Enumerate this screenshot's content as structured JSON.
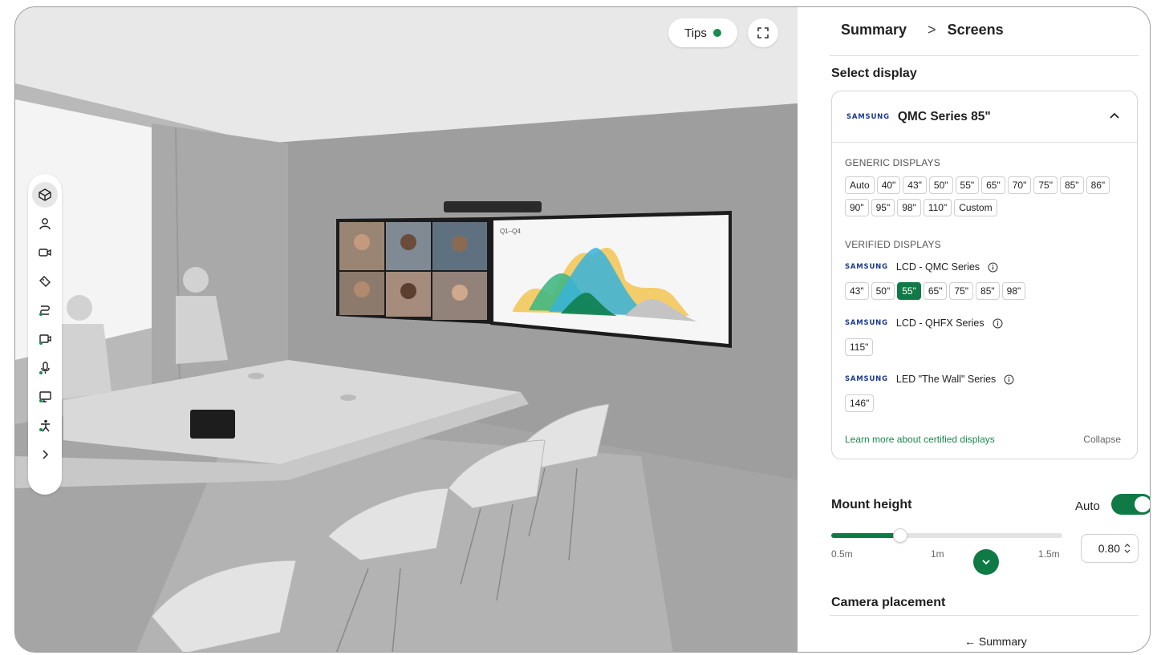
{
  "viewport": {
    "tips_label": "Tips",
    "tips_status_color": "#1d8a4f",
    "fullscreen_icon": "fullscreen-icon",
    "screen_chart_label": "Q1–Q4",
    "toolbar": [
      {
        "icon": "room-icon",
        "active": true
      },
      {
        "icon": "person-icon",
        "active": false
      },
      {
        "icon": "camera-icon",
        "active": false
      },
      {
        "icon": "tag-icon",
        "active": false
      },
      {
        "icon": "cable-icon",
        "active": false
      },
      {
        "icon": "display-camera-icon",
        "active": false
      },
      {
        "icon": "microphone-icon",
        "active": false
      },
      {
        "icon": "screen-icon",
        "active": false
      },
      {
        "icon": "accessibility-icon",
        "active": false
      },
      {
        "icon": "chevron-right-icon",
        "active": false
      }
    ]
  },
  "panel": {
    "breadcrumb": {
      "root": "Summary",
      "separator": ">",
      "current": "Screens"
    },
    "select_display_title": "Select display",
    "selected_display": {
      "brand": "SAMSUNG",
      "name": "QMC Series 85\""
    },
    "generic_header": "GENERIC DISPLAYS",
    "generic_sizes": [
      "Auto",
      "40\"",
      "43\"",
      "50\"",
      "55\"",
      "65\"",
      "70\"",
      "75\"",
      "85\"",
      "86\"",
      "90\"",
      "95\"",
      "98\"",
      "110\"",
      "Custom"
    ],
    "verified_header": "VERIFIED DISPLAYS",
    "verified": [
      {
        "brand": "SAMSUNG",
        "name": "LCD - QMC Series",
        "sizes": [
          "43\"",
          "50\"",
          "55\"",
          "65\"",
          "75\"",
          "85\"",
          "98\""
        ],
        "selected": "55\""
      },
      {
        "brand": "SAMSUNG",
        "name": "LCD - QHFX Series",
        "sizes": [
          "115\""
        ],
        "selected": ""
      },
      {
        "brand": "SAMSUNG",
        "name": "LED \"The Wall\" Series",
        "sizes": [
          "146\""
        ],
        "selected": ""
      }
    ],
    "learn_more": "Learn more about certified displays",
    "collapse": "Collapse",
    "mount_height": {
      "title": "Mount height",
      "auto_label": "Auto",
      "auto_enabled": true,
      "slider_value": 0.8,
      "slider_min": 0.5,
      "slider_max": 1.5,
      "ticks": [
        "0.5m",
        "1m",
        "1.5m"
      ],
      "input_value": "0.80"
    },
    "camera_placement_title": "Camera placement",
    "back_label": "← Summary",
    "accent_color": "#0f7a45"
  }
}
